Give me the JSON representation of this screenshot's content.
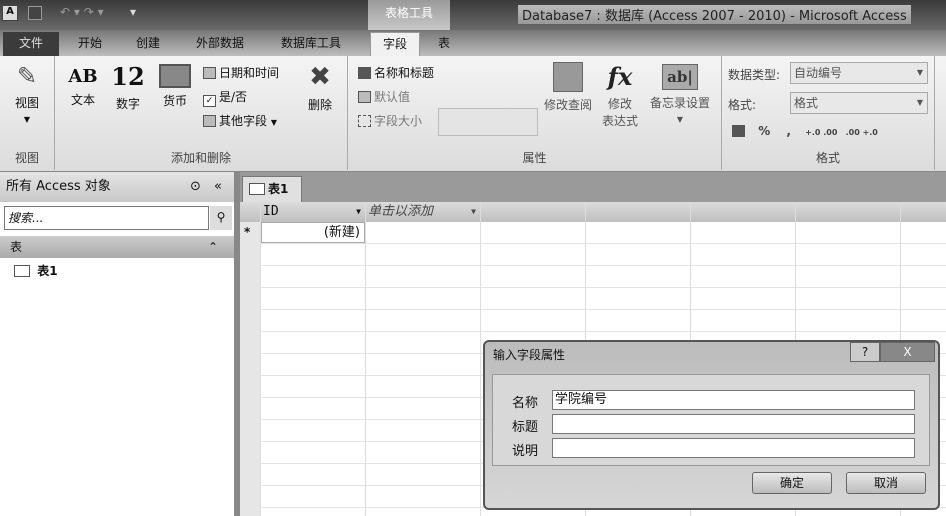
{
  "window": {
    "title": "Database7 : 数据库 (Access 2007 - 2010) - Microsoft Access",
    "context_tab_group": "表格工具"
  },
  "tabs": [
    "文件",
    "开始",
    "创建",
    "外部数据",
    "数据库工具",
    "字段",
    "表"
  ],
  "ribbon": {
    "view_group": {
      "label": "视图",
      "button": "视图"
    },
    "add_delete": {
      "label": "添加和删除",
      "text": "文本",
      "number": "数字",
      "currency": "货币",
      "datetime": "日期和时间",
      "yesno": "是/否",
      "more": "其他字段",
      "delete": "删除",
      "ab": "AB",
      "twelve": "12"
    },
    "properties": {
      "label": "属性",
      "name_caption": "名称和标题",
      "default": "默认值",
      "field_size": "字段大小",
      "modify_lookup": "修改查阅",
      "modify_expr_1": "修改",
      "modify_expr_2": "表达式",
      "memo": "备忘录设置",
      "fx": "fx",
      "abl": "ab|"
    },
    "format": {
      "label": "格式",
      "datatype_label": "数据类型:",
      "datatype_value": "自动编号",
      "format_label": "格式:",
      "format_value": "格式",
      "percent": "%",
      "comma": ",",
      "inc": "+.0 .00",
      "dec": ".00 +.0"
    }
  },
  "nav": {
    "title": "所有 Access 对象",
    "search_placeholder": "搜索...",
    "group": "表",
    "items": [
      "表1"
    ]
  },
  "datasheet": {
    "tab": "表1",
    "columns": [
      "ID",
      "单击以添加"
    ],
    "new_row_marker": "*",
    "new_row_value": "(新建)"
  },
  "dialog": {
    "title": "输入字段属性",
    "help": "?",
    "close": "X",
    "fields": [
      {
        "label": "名称",
        "value": "学院编号"
      },
      {
        "label": "标题",
        "value": ""
      },
      {
        "label": "说明",
        "value": ""
      }
    ],
    "ok": "确定",
    "cancel": "取消"
  }
}
